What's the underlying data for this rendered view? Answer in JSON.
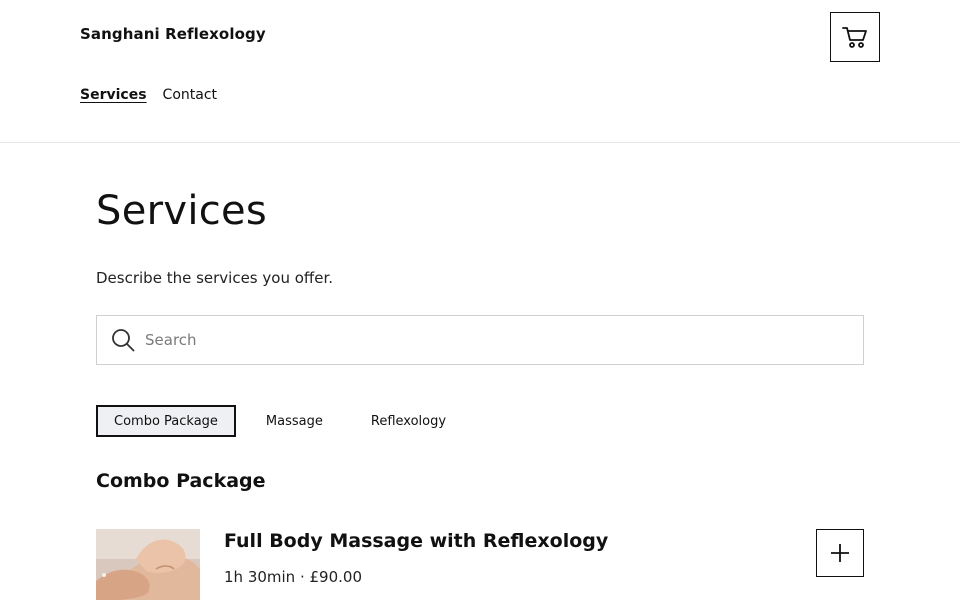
{
  "header": {
    "brand": "Sanghani Reflexology",
    "cart_icon": "cart-icon",
    "nav": [
      {
        "label": "Services",
        "active": true
      },
      {
        "label": "Contact",
        "active": false
      }
    ]
  },
  "main": {
    "title": "Services",
    "description": "Describe the services you offer.",
    "search": {
      "placeholder": "Search",
      "value": "",
      "icon": "search-icon"
    },
    "tabs": [
      {
        "label": "Combo Package",
        "active": true
      },
      {
        "label": "Massage",
        "active": false
      },
      {
        "label": "Reflexology",
        "active": false
      }
    ],
    "section_title": "Combo Package",
    "services": [
      {
        "name": "Full Body Massage with Reflexology",
        "meta": "1h 30min · £90.00",
        "add_icon": "plus-icon"
      }
    ]
  },
  "colors": {
    "text": "#111111",
    "border": "#cfcfcf",
    "active_tab_bg": "#eef0f3",
    "divider": "#e6e6e6"
  }
}
